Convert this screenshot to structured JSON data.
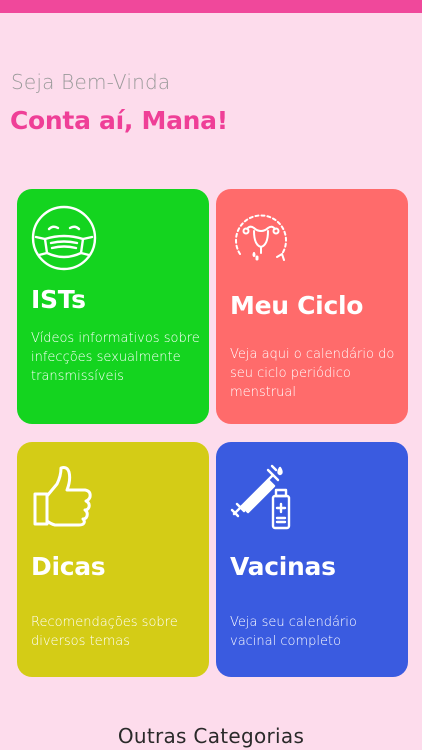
{
  "header": {
    "greeting": "Seja Bem-Vinda",
    "title": "Conta aí, Mana!"
  },
  "cards": [
    {
      "title": "ISTs",
      "description": "Vídeos informativos sobre infecções sexualmente transmissíveis",
      "icon": "face-mask-icon",
      "color": "#14d41f"
    },
    {
      "title": "Meu Ciclo",
      "description": "Veja aqui o calendário do seu ciclo periódico menstrual",
      "icon": "uterus-cycle-icon",
      "color": "#ff6b6b"
    },
    {
      "title": "Dicas",
      "description": "Recomendações sobre diversos temas",
      "icon": "thumbs-up-icon",
      "color": "#d4cc16"
    },
    {
      "title": "Vacinas",
      "description": "Veja seu calendário vacinal completo",
      "icon": "vaccine-icon",
      "color": "#3a5be0"
    }
  ],
  "footer": {
    "other_categories": "Outras Categorias"
  },
  "colors": {
    "background": "#fddcec",
    "accent": "#f0489b",
    "title": "#ef3f97"
  }
}
